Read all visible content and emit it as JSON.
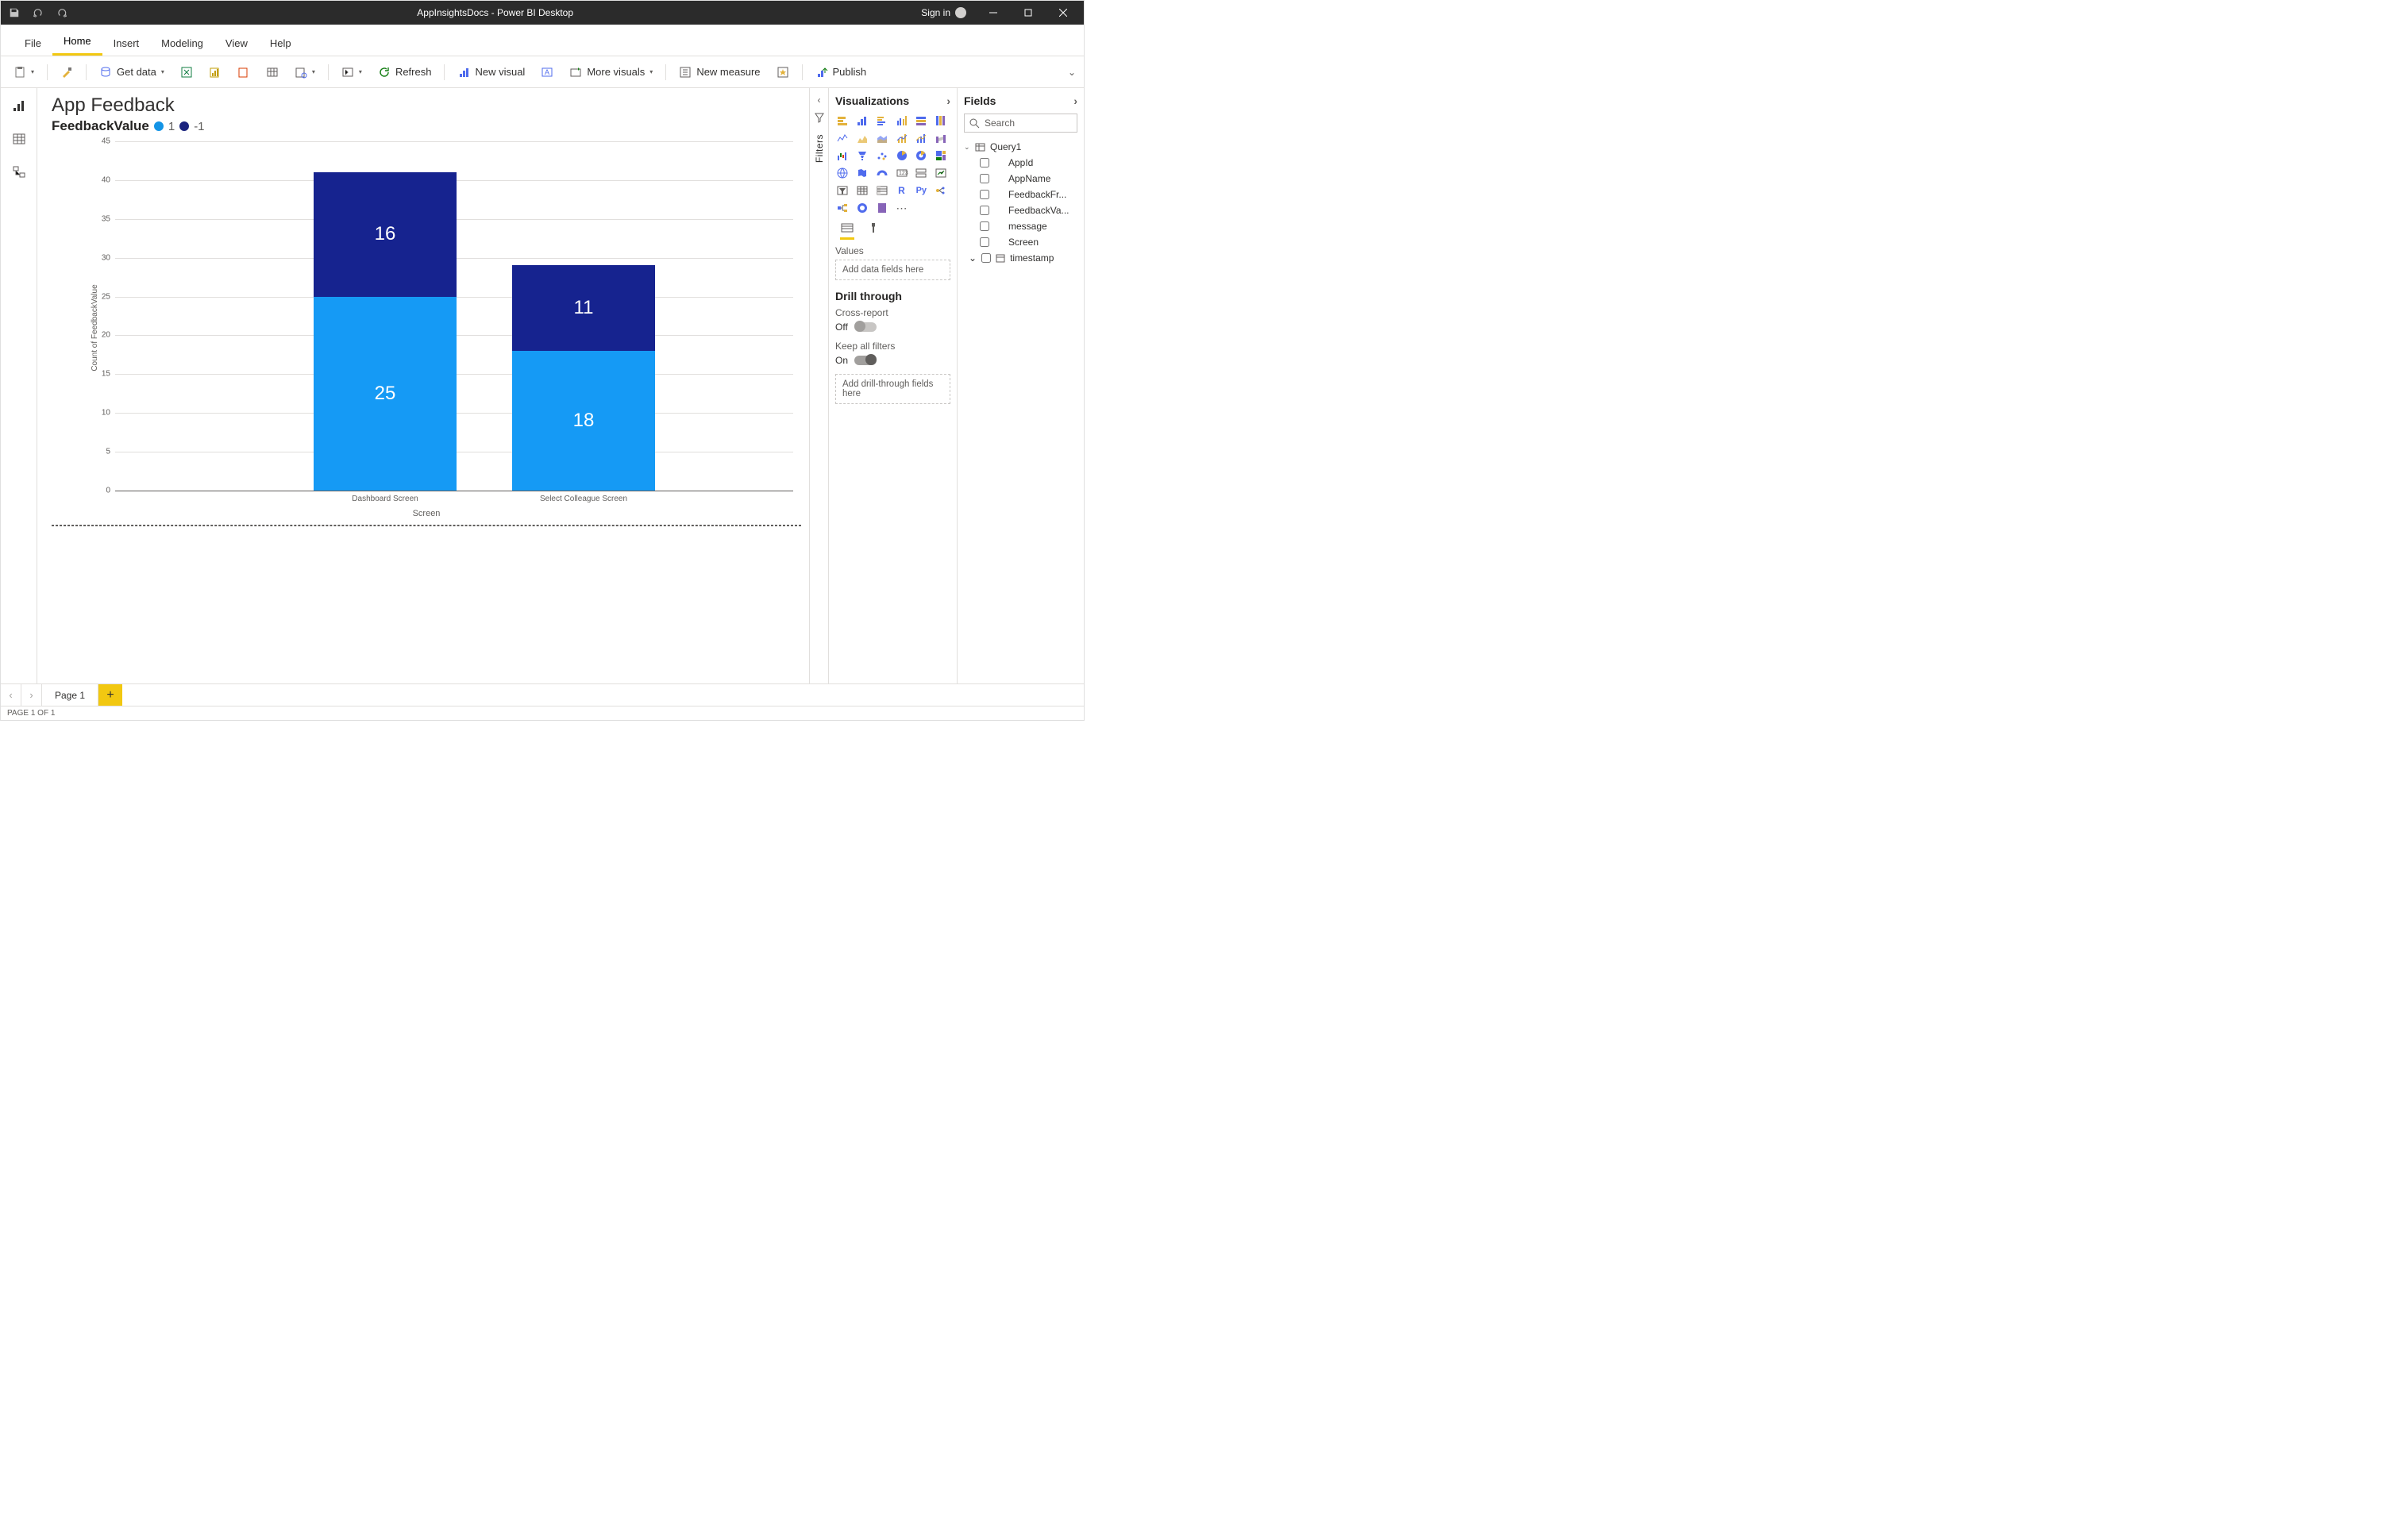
{
  "window": {
    "title": "AppInsightsDocs - Power BI Desktop",
    "signin": "Sign in"
  },
  "menu": {
    "file": "File",
    "items": [
      "Home",
      "Insert",
      "Modeling",
      "View",
      "Help"
    ],
    "active": "Home"
  },
  "ribbon": {
    "getdata": "Get data",
    "refresh": "Refresh",
    "newvisual": "New visual",
    "morevisuals": "More visuals",
    "newmeasure": "New measure",
    "publish": "Publish"
  },
  "report": {
    "title": "App Feedback",
    "legend_field": "FeedbackValue",
    "legend": [
      {
        "color": "sky",
        "label": "1"
      },
      {
        "color": "navy",
        "label": "-1"
      }
    ],
    "xaxis": "Screen",
    "yaxis": "Count of FeedbackValue"
  },
  "chart_data": {
    "type": "bar",
    "stacked": true,
    "title": "App Feedback",
    "xlabel": "Screen",
    "ylabel": "Count of FeedbackValue",
    "ylim": [
      0,
      45
    ],
    "yticks": [
      0,
      5,
      10,
      15,
      20,
      25,
      30,
      35,
      40,
      45
    ],
    "categories": [
      "Dashboard Screen",
      "Select Colleague Screen"
    ],
    "series": [
      {
        "name": "1",
        "color": "#159af5",
        "values": [
          25,
          18
        ]
      },
      {
        "name": "-1",
        "color": "#16238f",
        "values": [
          16,
          11
        ]
      }
    ]
  },
  "filters_pane": {
    "label": "Filters"
  },
  "viz_pane": {
    "title": "Visualizations",
    "values_label": "Values",
    "values_placeholder": "Add data fields here",
    "drill_title": "Drill through",
    "cross_label": "Cross-report",
    "cross_state": "Off",
    "keep_label": "Keep all filters",
    "keep_state": "On",
    "drill_placeholder": "Add drill-through fields here"
  },
  "fields_pane": {
    "title": "Fields",
    "search_placeholder": "Search",
    "tables": [
      {
        "name": "Query1",
        "expanded": true,
        "fields": [
          "AppId",
          "AppName",
          "FeedbackFr...",
          "FeedbackVa...",
          "message",
          "Screen"
        ],
        "date_fields": [
          "timestamp"
        ]
      }
    ]
  },
  "pages": {
    "tab": "Page 1",
    "status": "PAGE 1 OF 1"
  }
}
